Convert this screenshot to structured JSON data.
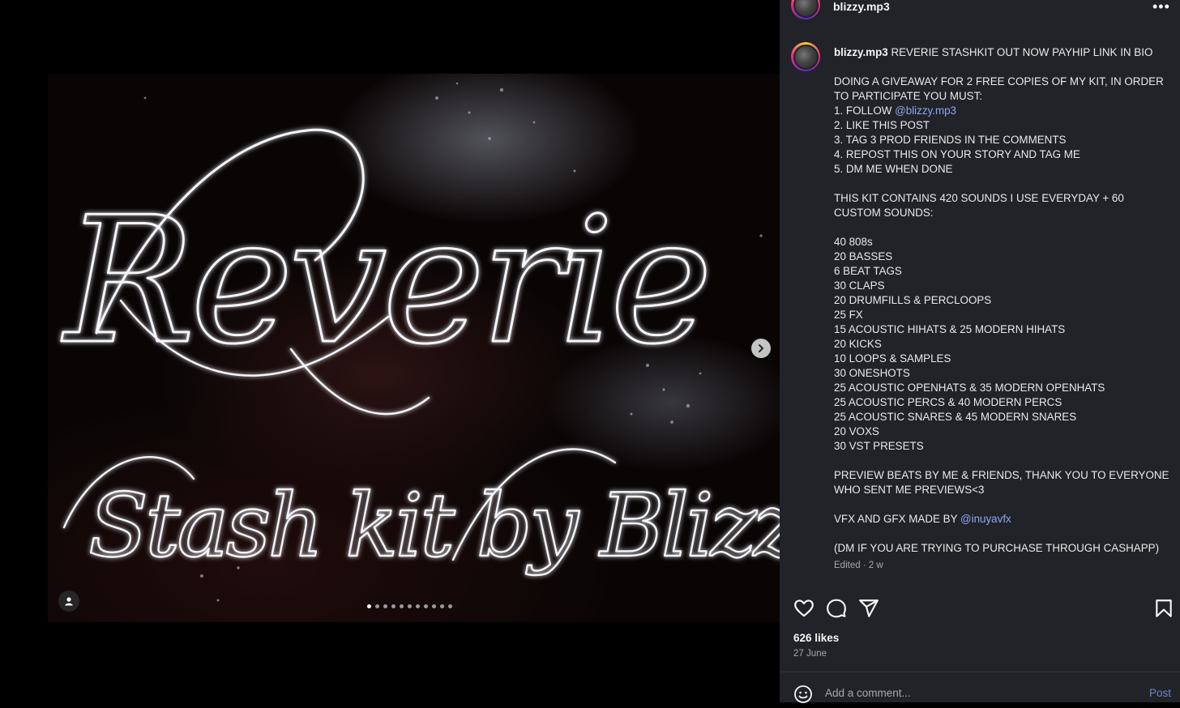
{
  "post": {
    "username": "blizzy.mp3",
    "header_username": "blizzy.mp3",
    "more_label": "•••",
    "media": {
      "artwork_title": "Reverie",
      "artwork_subtitle": "Stash kit by Blizzy",
      "carousel_count": 11,
      "carousel_active": 0
    },
    "caption": {
      "username": "blizzy.mp3",
      "lines": [
        " REVERIE STASHKIT OUT NOW PAYHIP LINK IN BIO",
        "",
        "DOING A GIVEAWAY FOR 2 FREE COPIES OF MY KIT, IN ORDER TO PARTICIPATE YOU MUST:",
        "1. FOLLOW ",
        "2. LIKE THIS POST",
        "3. TAG 3 PROD FRIENDS IN THE COMMENTS",
        "4. REPOST THIS ON YOUR STORY AND TAG ME",
        "5. DM ME WHEN DONE",
        "",
        "THIS KIT CONTAINS 420 SOUNDS I USE EVERYDAY + 60 CUSTOM SOUNDS:",
        "",
        "40 808s",
        "20 BASSES",
        "6 BEAT TAGS",
        "30 CLAPS",
        "20 DRUMFILLS & PERCLOOPS",
        "25 FX",
        "15 ACOUSTIC HIHATS & 25 MODERN HIHATS",
        "20 KICKS",
        "10 LOOPS & SAMPLES",
        "30 ONESHOTS",
        "25 ACOUSTIC OPENHATS & 35 MODERN OPENHATS",
        "25 ACOUSTIC PERCS & 40 MODERN PERCS",
        "25 ACOUSTIC SNARES & 45 MODERN SNARES",
        "20 VOXS",
        "30 VST PRESETS",
        "",
        "PREVIEW BEATS BY ME & FRIENDS, THANK YOU TO EVERYONE WHO SENT ME PREVIEWS<3",
        "",
        "VFX AND GFX MADE BY ",
        "",
        "(DM IF YOU ARE TRYING TO PURCHASE THROUGH CASHAPP)"
      ],
      "mention_follow": "@blizzy.mp3",
      "mention_vfx": "@inuyavfx"
    },
    "edited": "Edited · 2 w",
    "likes": "626 likes",
    "date": "27 June",
    "comment": {
      "placeholder": "Add a comment...",
      "post_label": "Post"
    },
    "icons": {
      "like": "heart-icon",
      "comment": "speech-bubble-icon",
      "share": "paper-plane-icon",
      "save": "bookmark-icon",
      "emoji": "smiley-icon",
      "next": "chevron-right-icon",
      "tag": "person-icon"
    },
    "colors": {
      "panel_bg": "#212328",
      "mention": "#8ea6f0",
      "post_button": "#6f86c9"
    }
  }
}
